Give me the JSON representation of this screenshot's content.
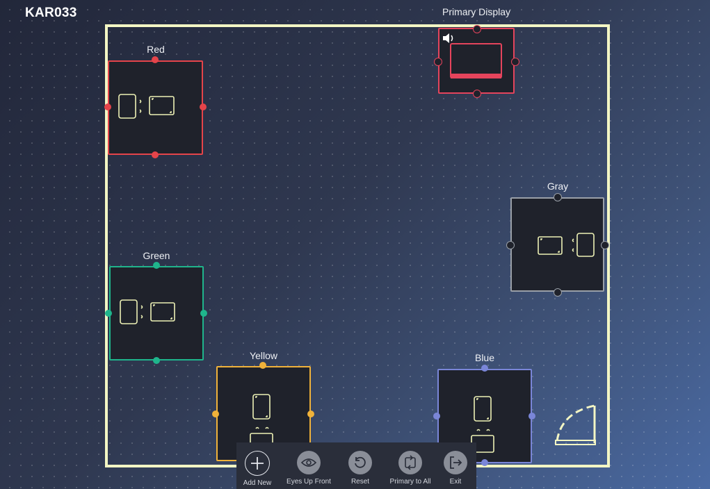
{
  "room": {
    "title": "KAR033",
    "wall_color": "#f3f6c4"
  },
  "primary_display": {
    "label": "Primary Display",
    "color": "#e5445c",
    "audio_icon": "speaker-icon"
  },
  "pods": {
    "red": {
      "label": "Red",
      "color": "#e5444a"
    },
    "green": {
      "label": "Green",
      "color": "#1fb58c"
    },
    "yellow": {
      "label": "Yellow",
      "color": "#f0b23a"
    },
    "gray": {
      "label": "Gray",
      "color": "#9aa0a8"
    },
    "blue": {
      "label": "Blue",
      "color": "#7a86d8"
    }
  },
  "device_icon_color": "#eef2b6",
  "toolbar": {
    "add_new": "Add New",
    "eyes_up_front": "Eyes Up Front",
    "reset": "Reset",
    "primary_to_all": "Primary to All",
    "exit": "Exit"
  }
}
